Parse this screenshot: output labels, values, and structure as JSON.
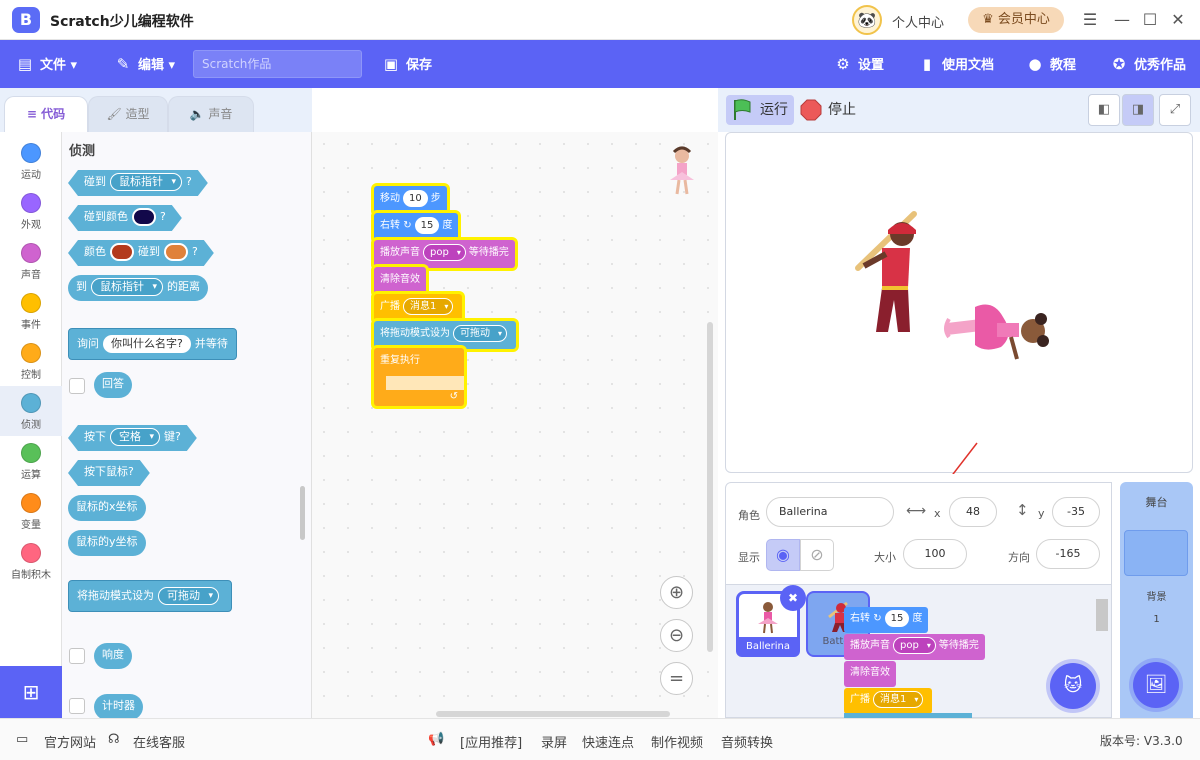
{
  "app": {
    "title": "Scratch少儿编程软件",
    "logo_char": "B",
    "user_center": "个人中心",
    "vip": "会员中心"
  },
  "menu": {
    "file": "文件",
    "edit": "编辑",
    "project_placeholder": "Scratch作品",
    "save": "保存",
    "settings": "设置",
    "docs": "使用文档",
    "tutorial": "教程",
    "showcase": "优秀作品"
  },
  "tabs": {
    "code": "代码",
    "costume": "造型",
    "sound": "声音"
  },
  "categories": [
    {
      "label": "运动",
      "color": "#4c97ff"
    },
    {
      "label": "外观",
      "color": "#9966ff"
    },
    {
      "label": "声音",
      "color": "#cf63cf"
    },
    {
      "label": "事件",
      "color": "#ffbf00"
    },
    {
      "label": "控制",
      "color": "#ffab19"
    },
    {
      "label": "侦测",
      "color": "#5cb1d6"
    },
    {
      "label": "运算",
      "color": "#59c059"
    },
    {
      "label": "变量",
      "color": "#ff8c1a"
    },
    {
      "label": "自制积木",
      "color": "#ff6680"
    }
  ],
  "palette": {
    "heading": "侦测",
    "touch": "碰到",
    "mouse_pointer": "鼠标指针",
    "q": "?",
    "touch_color": "碰到颜色",
    "color_word": "颜色",
    "touch_word": "碰到",
    "to": "到",
    "distance": "的距离",
    "ask": "询问",
    "ask_default": "你叫什么名字?",
    "and_wait": "并等待",
    "answer": "回答",
    "key_press": "按下",
    "space": "空格",
    "key": "键?",
    "mouse_down": "按下鼠标?",
    "mouse_x": "鼠标的x坐标",
    "mouse_y": "鼠标的y坐标",
    "drag_mode": "将拖动模式设为",
    "draggable": "可拖动",
    "loudness": "响度",
    "timer": "计时器"
  },
  "script": {
    "move": "移动",
    "steps_val": "10",
    "steps": "步",
    "turn": "右转",
    "turn_icon": "↻",
    "deg_val": "15",
    "deg": "度",
    "play_sound": "播放声音",
    "sound_name": "pop",
    "until_done": "等待播完",
    "clear_effects": "清除音效",
    "broadcast": "广播",
    "message": "消息1",
    "set_drag": "将拖动模式设为",
    "draggable": "可拖动",
    "forever": "重复执行",
    "loop_icon": "↺"
  },
  "stage": {
    "run": "运行",
    "stop": "停止"
  },
  "sprite_info": {
    "sprite_label": "角色",
    "sprite_name": "Ballerina",
    "x_label": "x",
    "x_val": "48",
    "y_label": "y",
    "y_val": "-35",
    "show_label": "显示",
    "size_label": "大小",
    "size_val": "100",
    "dir_label": "方向",
    "dir_val": "-165"
  },
  "sprites": [
    {
      "name": "Ballerina"
    },
    {
      "name": "Batter"
    }
  ],
  "stage_panel": {
    "title": "舞台",
    "backdrops_label": "背景",
    "backdrops_count": "1"
  },
  "status": {
    "website": "官方网站",
    "service": "在线客服",
    "recommend": "[应用推荐]",
    "record": "录屏",
    "clicker": "快速连点",
    "video": "制作视频",
    "audio": "音频转换",
    "version": "版本号: V3.3.0"
  }
}
